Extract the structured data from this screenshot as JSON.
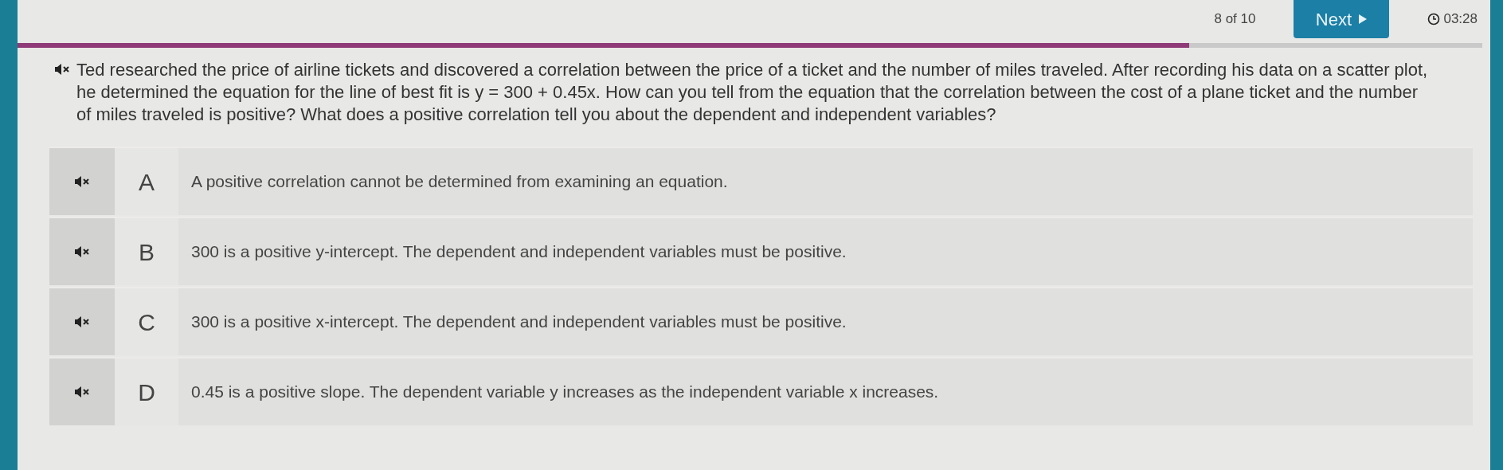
{
  "header": {
    "counter": "8 of 10",
    "next_button": "Next",
    "timer": "03:28"
  },
  "progress": {
    "level": 0.8
  },
  "question": {
    "text": "Ted researched the price of airline tickets and discovered a correlation between the price of a ticket and the number of miles traveled. After recording his data on a scatter plot, he determined the equation for the line of best fit is y = 300 + 0.45x. How can you tell from the equation that the correlation between the cost of a plane ticket and the number of miles traveled is positive? What does a positive correlation tell you about the dependent and independent variables?"
  },
  "options": [
    {
      "letter": "A",
      "text": "A positive correlation cannot be determined from examining an equation."
    },
    {
      "letter": "B",
      "text": "300 is a positive y-intercept. The dependent and independent variables must be positive."
    },
    {
      "letter": "C",
      "text": "300 is a positive x-intercept. The dependent and independent variables must be positive."
    },
    {
      "letter": "D",
      "text": "0.45 is a positive slope. The dependent variable y increases as the independent variable x increases."
    }
  ]
}
